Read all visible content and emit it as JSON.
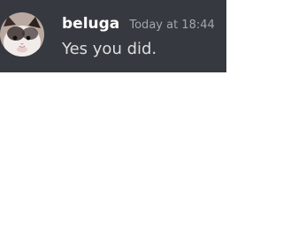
{
  "message": {
    "author": "beluga",
    "timestamp": "Today at 18:44",
    "text": "Yes you did.",
    "avatar_icon": "cat-avatar-icon"
  },
  "colors": {
    "background": "#36393f",
    "username": "#ffffff",
    "timestamp": "#a3a6aa",
    "text": "#dcddde"
  }
}
